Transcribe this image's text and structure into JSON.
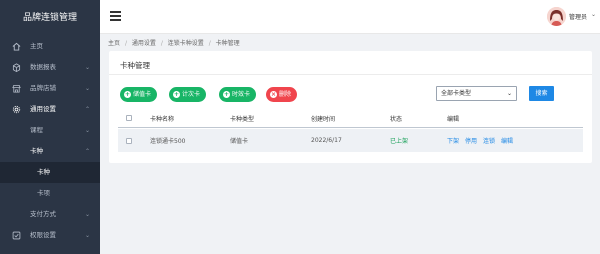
{
  "sidebar": {
    "brand": "品牌连锁管理",
    "items": [
      {
        "label": "主页",
        "icon": "home-icon"
      },
      {
        "label": "数据报表",
        "icon": "box-icon",
        "caret": "⌄"
      },
      {
        "label": "品牌店铺",
        "icon": "store-icon",
        "caret": "⌄"
      },
      {
        "label": "通用设置",
        "icon": "gear-icon",
        "caret": "⌃"
      },
      {
        "label": "课程",
        "caret": "⌄"
      },
      {
        "label": "卡种",
        "caret": "⌃"
      },
      {
        "label": "卡种"
      },
      {
        "label": "卡项"
      },
      {
        "label": "支付方式",
        "caret": "⌄"
      },
      {
        "label": "权限设置",
        "icon": "check-icon",
        "caret": "⌄"
      }
    ]
  },
  "header": {
    "user_name": "管理员",
    "user_caret": "⌄"
  },
  "breadcrumb": [
    "主页",
    "通用设置",
    "连锁卡种设置",
    "卡种管理"
  ],
  "breadcrumb_sep": "/",
  "card": {
    "title": "卡种管理",
    "buttons": [
      {
        "label": "储值卡",
        "icon": "+"
      },
      {
        "label": "计次卡",
        "icon": "+"
      },
      {
        "label": "时效卡",
        "icon": "+"
      },
      {
        "label": "删除",
        "icon": "×"
      }
    ],
    "filter": {
      "value": "全部卡类型",
      "caret": "⌄"
    },
    "search_label": "搜索"
  },
  "table": {
    "columns": [
      "卡种名称",
      "卡种类型",
      "创建时间",
      "状态",
      "编辑"
    ],
    "rows": [
      {
        "name": "连锁通卡500",
        "type": "储值卡",
        "created": "2022/6/17",
        "status": "已上架",
        "actions": [
          "下架",
          "停用",
          "连锁",
          "编辑"
        ]
      }
    ]
  },
  "colors": {
    "sidebar_bg": "#2b3545",
    "accent": "#1e88e5",
    "green": "#18b566",
    "red": "#f0454d",
    "status_ok": "#18a058"
  }
}
